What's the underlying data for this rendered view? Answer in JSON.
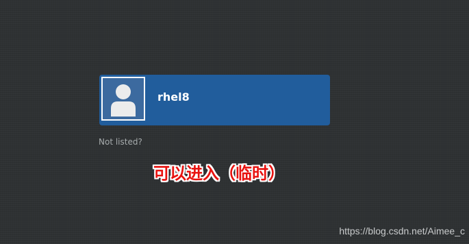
{
  "login": {
    "user": {
      "username": "rhel8",
      "avatar_icon": "user-avatar-icon"
    },
    "not_listed_label": "Not listed?"
  },
  "annotation": {
    "text": "可以进入（临时）",
    "color": "#e8120f"
  },
  "watermark": {
    "text": "https://blog.csdn.net/Aimee_c"
  },
  "colors": {
    "background": "#2e3133",
    "card": "#215d9c",
    "muted_text": "#a7acad"
  }
}
